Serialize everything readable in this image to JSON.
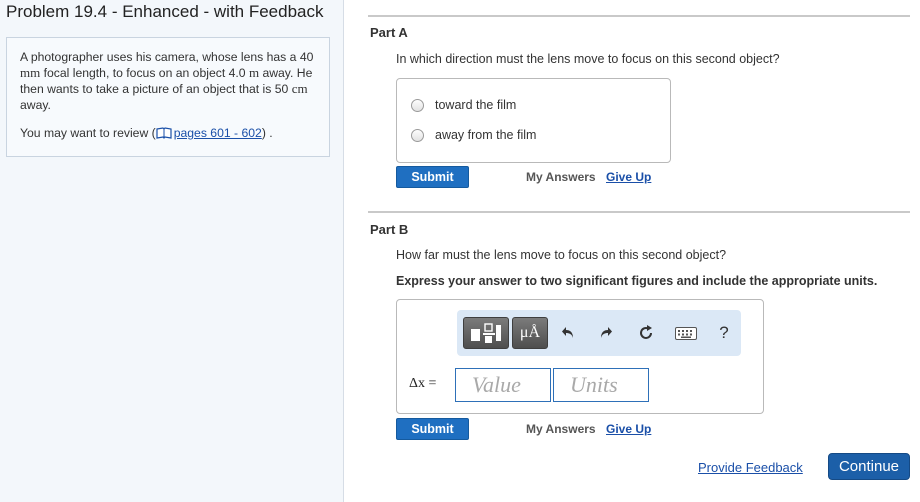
{
  "problem": {
    "title": "Problem 19.4 - Enhanced - with Feedback",
    "text_parts": [
      "A photographer uses his camera, whose lens has a ",
      "40",
      " ",
      "mm",
      " focal length, to focus on an object ",
      "4.0",
      " ",
      "m",
      " away. He then wants to take a picture of an object that is ",
      "50",
      " ",
      "cm",
      " away."
    ],
    "review_prefix": "You may want to review (",
    "review_link": "pages 601 - 602",
    "review_suffix": ") ."
  },
  "icons": {
    "book": "book-icon",
    "toolbar": [
      "templates-icon",
      "units-icon",
      "undo-icon",
      "redo-icon",
      "reset-icon",
      "keyboard-icon",
      "help-icon"
    ]
  },
  "part_a": {
    "heading": "Part A",
    "question": "In which direction must the lens move to focus on this second object?",
    "options": [
      "toward the film",
      "away from the film"
    ],
    "submit_label": "Submit",
    "my_answers_label": "My Answers",
    "give_up_label": "Give Up"
  },
  "part_b": {
    "heading": "Part B",
    "question": "How far must the lens move to focus on this second object?",
    "instruction": "Express your answer to two significant figures and include the appropriate units.",
    "toolbar": {
      "units_label": "μÅ",
      "help_label": "?"
    },
    "variable_label": "Δx =",
    "value_placeholder": "Value",
    "units_placeholder": "Units",
    "submit_label": "Submit",
    "my_answers_label": "My Answers",
    "give_up_label": "Give Up"
  },
  "footer": {
    "feedback_label": "Provide Feedback",
    "continue_label": "Continue"
  },
  "colors": {
    "accent": "#1f6fc1",
    "link": "#1a4fa8",
    "panel_bg": "#f3f7fb",
    "toolbar_bg": "#dbe8f6"
  }
}
